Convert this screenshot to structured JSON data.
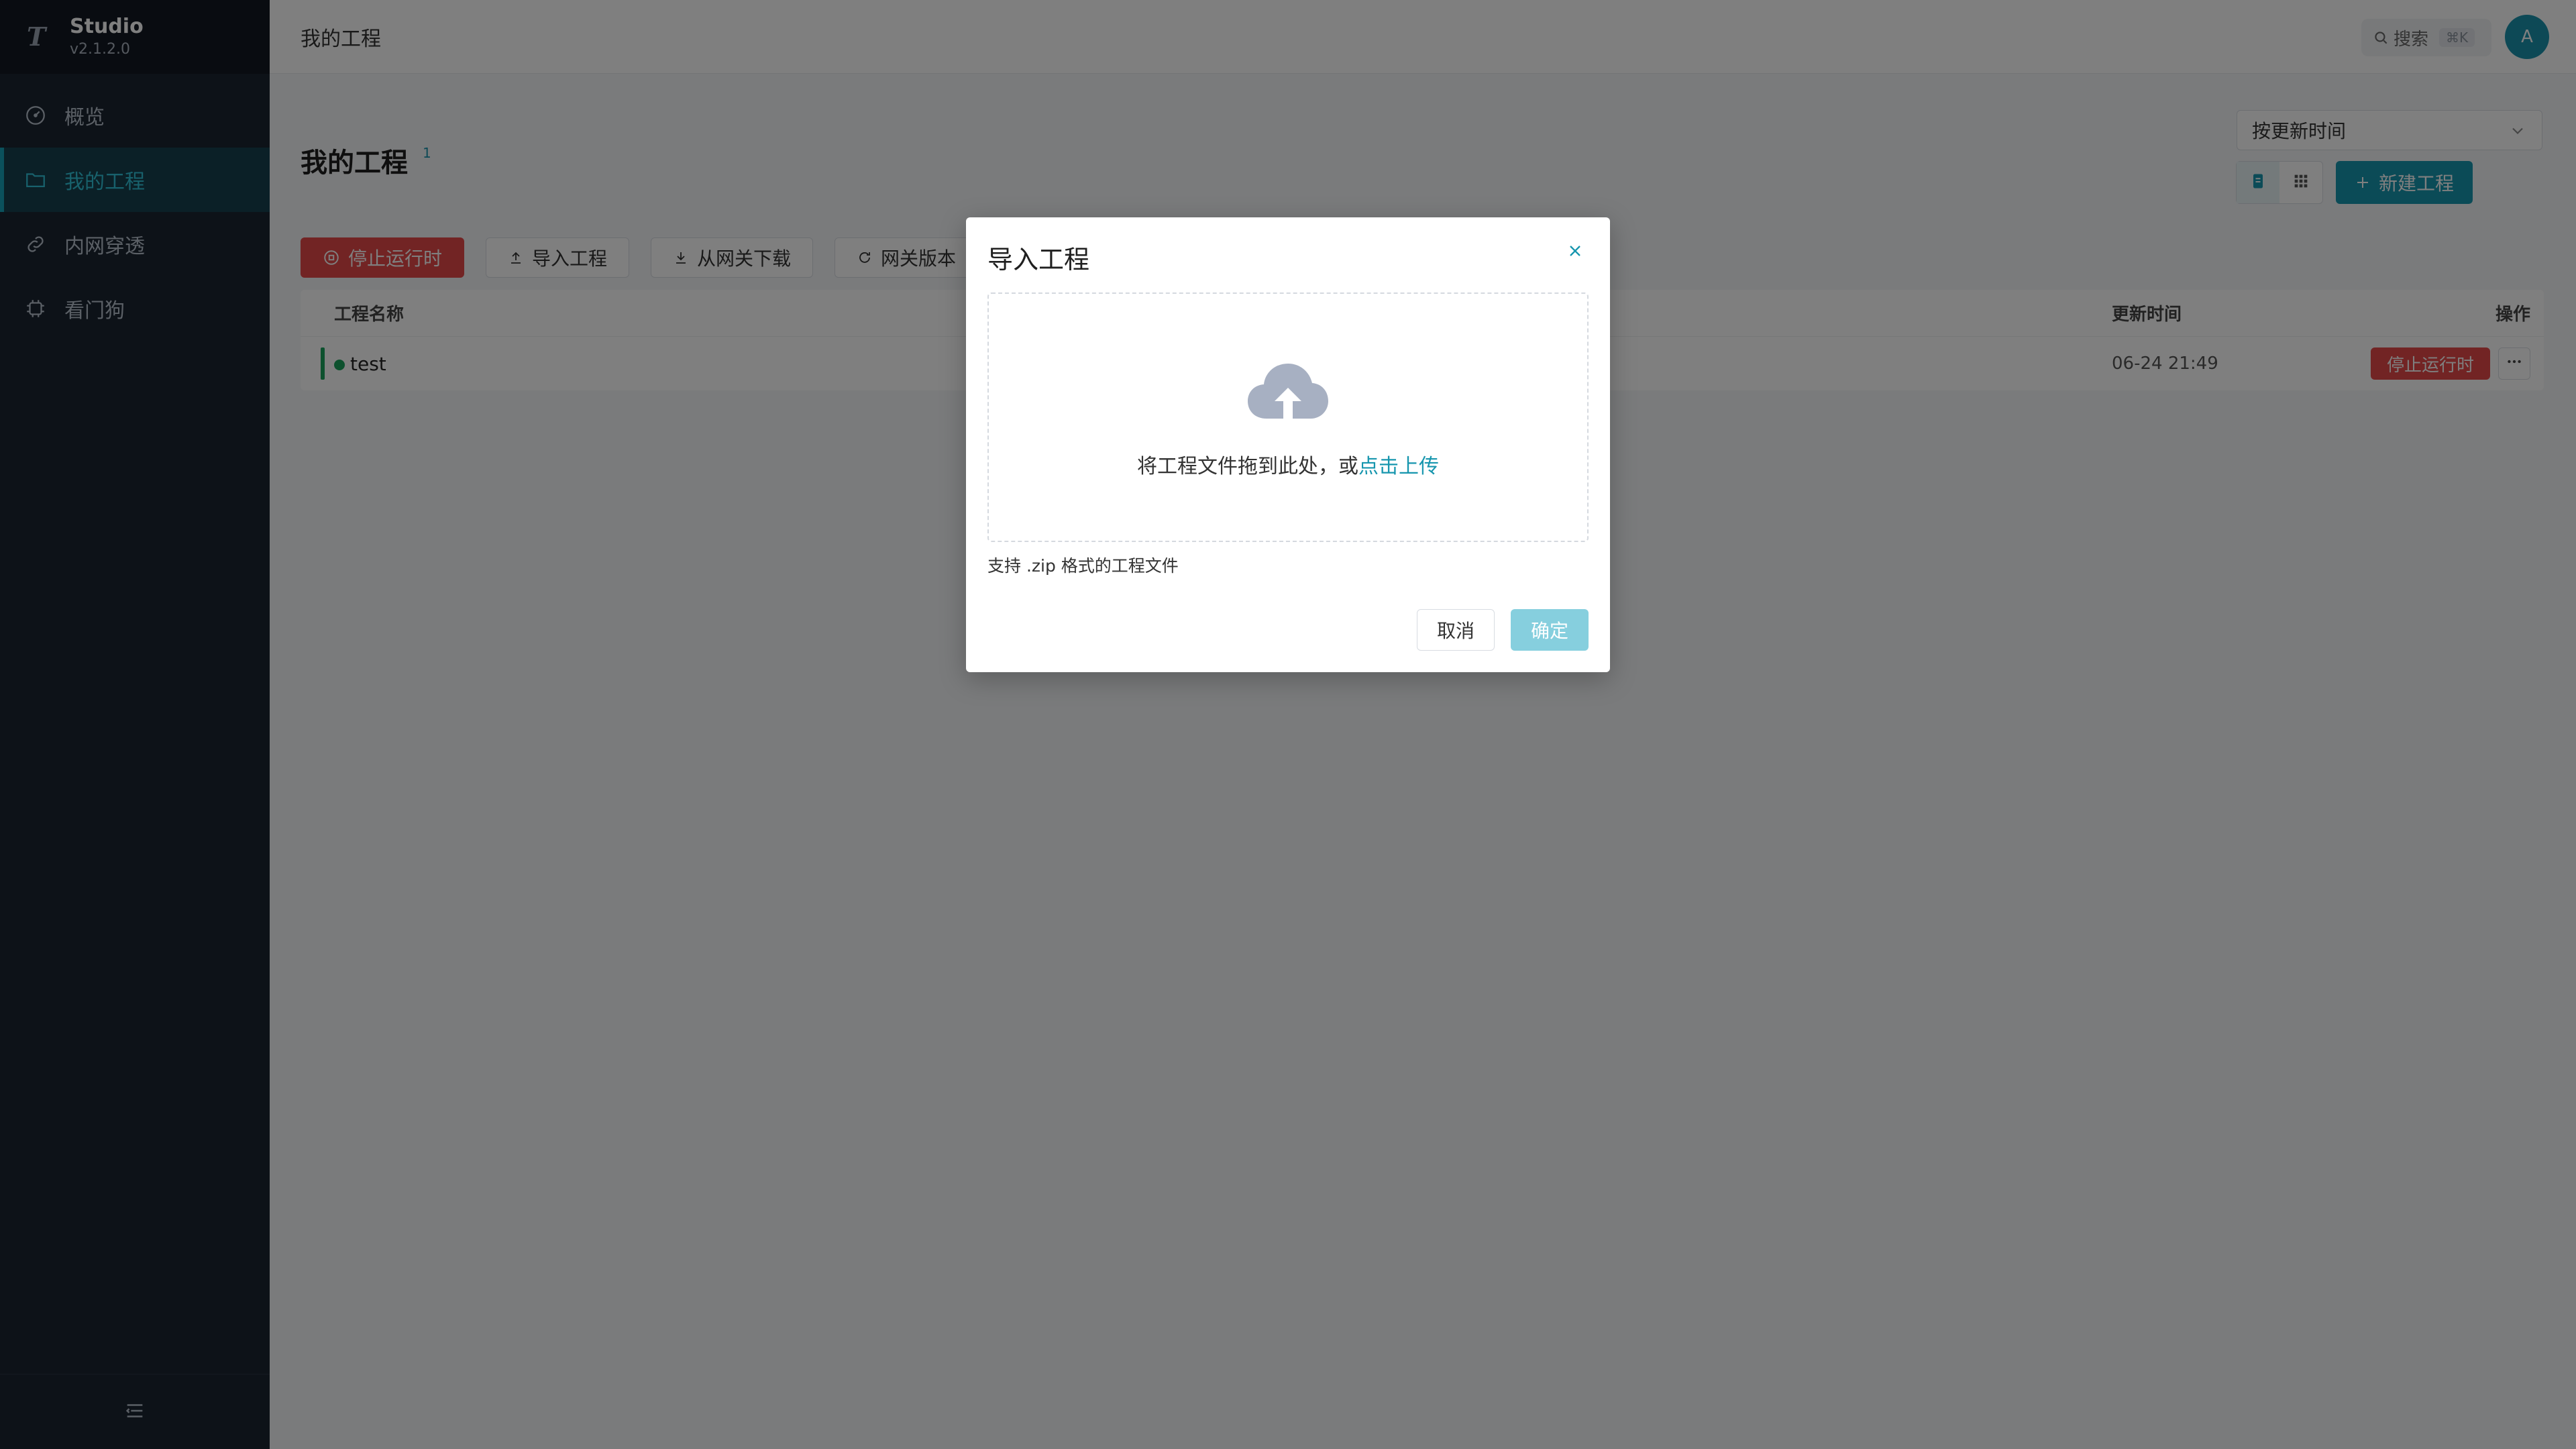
{
  "app": {
    "name": "Studio",
    "version": "v2.1.2.0",
    "logo_letter": "T"
  },
  "sidebar": {
    "items": [
      {
        "label": "概览",
        "icon": "gauge-icon",
        "active": false
      },
      {
        "label": "我的工程",
        "icon": "folder-icon",
        "active": true
      },
      {
        "label": "内网穿透",
        "icon": "link-icon",
        "active": false
      },
      {
        "label": "看门狗",
        "icon": "chip-icon",
        "active": false
      }
    ],
    "collapse_icon": "menu-collapse-icon"
  },
  "topbar": {
    "title": "我的工程",
    "search_label": "搜索",
    "search_shortcut": "⌘K",
    "avatar_letter": "A"
  },
  "page": {
    "title": "我的工程",
    "count": "1",
    "sort_value": "按更新时间",
    "new_project_label": "新建工程"
  },
  "toolbar": {
    "stop_runtime": "停止运行时",
    "import_project": "导入工程",
    "download_from_gateway": "从网关下载",
    "gateway_version": "网关版本"
  },
  "table": {
    "headers": {
      "name": "工程名称",
      "updated": "更新时间",
      "ops": "操作"
    },
    "rows": [
      {
        "name": "test",
        "updated": "06-24 21:49",
        "action": "停止运行时"
      }
    ]
  },
  "modal": {
    "title": "导入工程",
    "drop_text": "将工程文件拖到此处，或",
    "upload_link": "点击上传",
    "support_text": "支持 .zip 格式的工程文件",
    "cancel": "取消",
    "confirm": "确定"
  },
  "colors": {
    "accent": "#1796ae",
    "danger": "#e54848",
    "sidebar_bg": "#1b2431",
    "running": "#1aa35c"
  }
}
